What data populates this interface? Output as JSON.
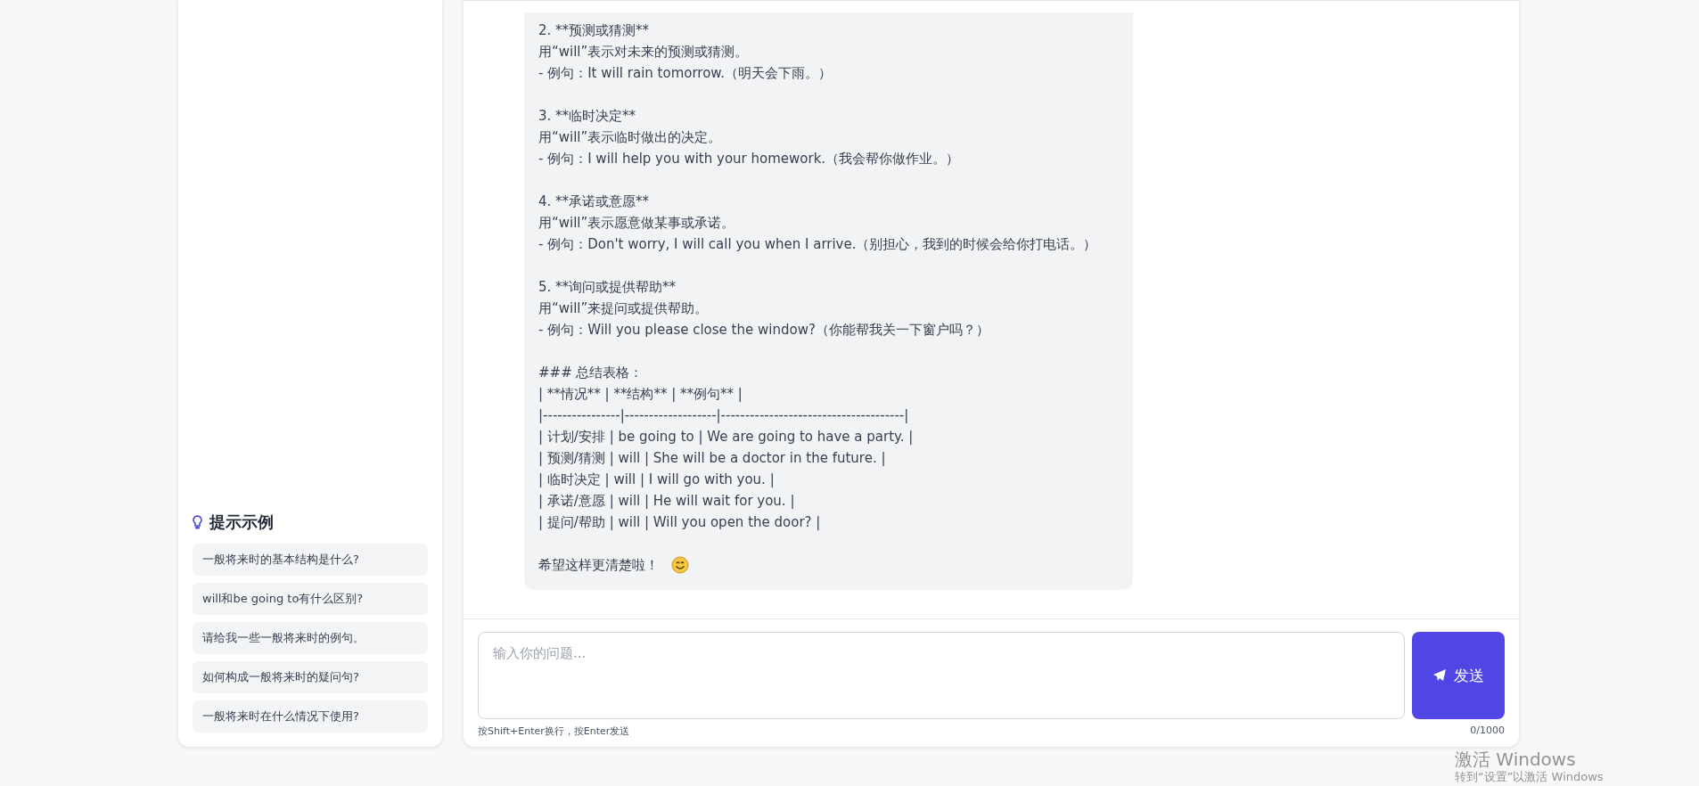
{
  "sidebar": {
    "title": "提示示例",
    "prompts": [
      {
        "text": "一般将来时的基本结构是什么?"
      },
      {
        "text": "will和be going to有什么区别?"
      },
      {
        "text": "请给我一些一般将来时的例句。"
      },
      {
        "text": "如何构成一般将来时的疑问句?"
      },
      {
        "text": "一般将来时在什么情况下使用?"
      }
    ]
  },
  "message": {
    "blocks": [
      [
        "2. **预测或猜测**",
        "用“will”表示对未来的预测或猜测。",
        "- 例句：It will rain tomorrow.（明天会下雨。）"
      ],
      [
        "3. **临时决定**",
        "用“will”表示临时做出的决定。",
        "- 例句：I will help you with your homework.（我会帮你做作业。）"
      ],
      [
        "4. **承诺或意愿**",
        "用“will”表示愿意做某事或承诺。",
        "- 例句：Don't worry, I will call you when I arrive.（别担心，我到的时候会给你打电话。）"
      ],
      [
        "5. **询问或提供帮助**",
        "用“will”来提问或提供帮助。",
        "- 例句：Will you please close the window?（你能帮我关一下窗户吗？）"
      ],
      [
        "### 总结表格：",
        "| **情况** | **结构** | **例句** |",
        "|----------------|-------------------|--------------------------------------|",
        "| 计划/安排 | be going to | We are going to have a party. |",
        "| 预测/猜测 | will | She will be a doctor in the future. |",
        "| 临时决定 | will | I will go with you. |",
        "| 承诺/意愿 | will | He will wait for you. |",
        "| 提问/帮助 | will | Will you open the door? |"
      ],
      [
        "希望这样更清楚啦！"
      ]
    ]
  },
  "input": {
    "placeholder": "输入你的问题...",
    "send": "发送",
    "hint": "按Shift+Enter换行，按Enter发送",
    "count": "0/1000"
  },
  "windows_activation": {
    "title": "激活 Windows",
    "subtitle": "转到“设置”以激活 Windows"
  }
}
